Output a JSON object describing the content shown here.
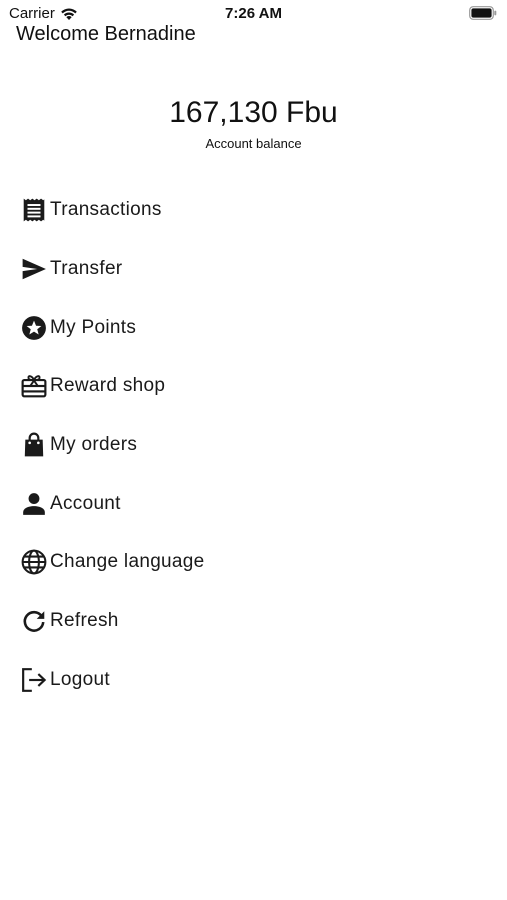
{
  "status_bar": {
    "carrier": "Carrier",
    "time": "7:26 AM"
  },
  "header": {
    "welcome": "Welcome Bernadine"
  },
  "balance": {
    "amount": "167,130 Fbu",
    "label": "Account balance"
  },
  "menu": {
    "items": [
      {
        "label": "Transactions",
        "icon": "receipt-icon"
      },
      {
        "label": "Transfer",
        "icon": "send-icon"
      },
      {
        "label": "My Points",
        "icon": "star-circle-icon"
      },
      {
        "label": "Reward shop",
        "icon": "gift-card-icon"
      },
      {
        "label": "My orders",
        "icon": "shopping-bag-icon"
      },
      {
        "label": "Account",
        "icon": "person-icon"
      },
      {
        "label": "Change language",
        "icon": "globe-icon"
      },
      {
        "label": "Refresh",
        "icon": "refresh-icon"
      },
      {
        "label": "Logout",
        "icon": "logout-icon"
      }
    ]
  },
  "colors": {
    "background": "#ffffff",
    "text": "#1a1a1a"
  }
}
